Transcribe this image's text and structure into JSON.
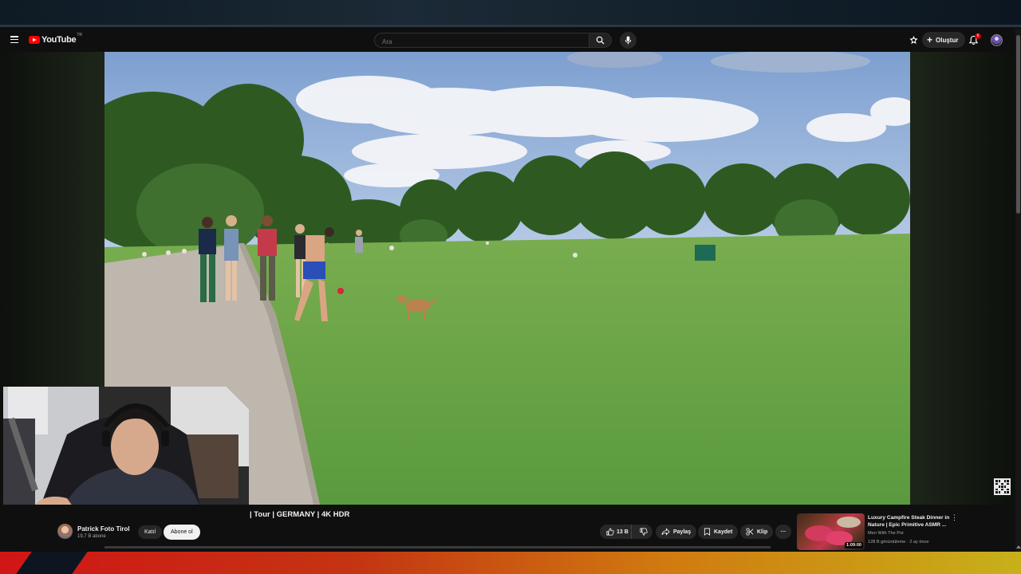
{
  "header": {
    "logo_text": "YouTube",
    "logo_region": "TR",
    "search_placeholder": "Ara",
    "create_label": "Oluştur",
    "notification_count": "6"
  },
  "video": {
    "title": "| Tour | GERMANY | 4K HDR",
    "progress_fraction": 0.0
  },
  "channel": {
    "name": "Patrick Foto Tirol",
    "subscribers": "19,7 B abone",
    "join_label": "Katıl",
    "subscribe_label": "Abone ol"
  },
  "actions": {
    "like_count": "13 B",
    "share_label": "Paylaş",
    "save_label": "Kaydet",
    "clip_label": "Klip",
    "more_label": "···"
  },
  "recommendation": {
    "title": "Luxury Campfire Steak Dinner in Nature | Epic Primitive ASMR ...",
    "channel": "Men With The Pot",
    "meta": "128 B görüntüleme · 2 ay önce",
    "duration": "1:09:00",
    "more_label": "⋮"
  },
  "icons": {
    "menu": "hamburger-menu-icon",
    "search": "search-icon",
    "mic": "microphone-icon",
    "create": "create-video-icon",
    "bell": "bell-icon",
    "like": "thumbs-up-icon",
    "dislike": "thumbs-down-icon",
    "share": "share-arrow-icon",
    "save": "bookmark-icon",
    "clip": "scissors-icon"
  },
  "colors": {
    "brand_red": "#ff0000",
    "background": "#0f0f0f",
    "pill": "#272727",
    "subscribe_bg": "#f1f1f1"
  }
}
